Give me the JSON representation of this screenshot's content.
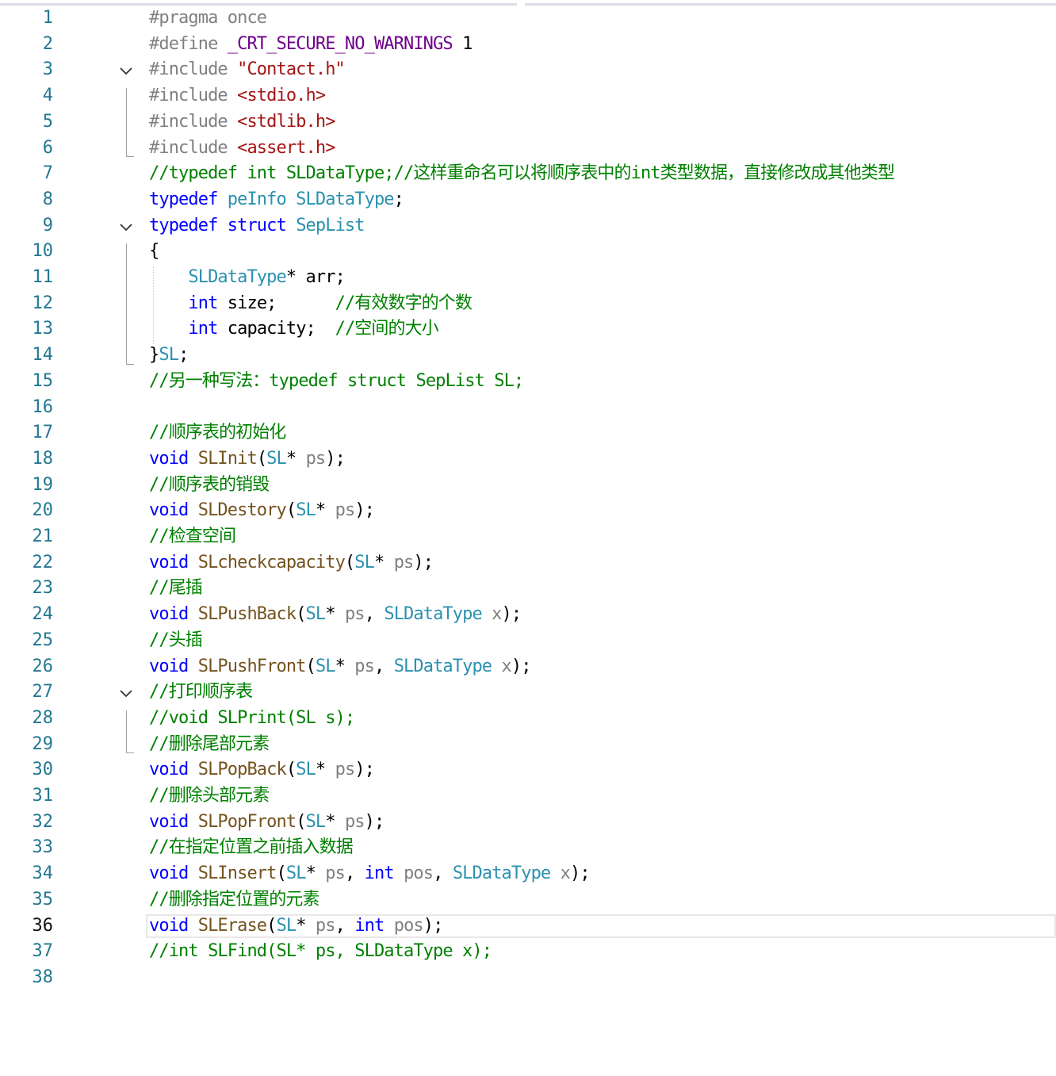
{
  "editor": {
    "active_line": 36,
    "colors": {
      "preprocessor": "#808080",
      "keyword": "#0000ff",
      "type": "#2b91af",
      "string": "#a31515",
      "comment": "#008000",
      "function": "#74531f",
      "macro": "#6f008a",
      "parameter": "#808080",
      "line_number": "#237893"
    },
    "fold_markers": [
      3,
      9,
      27
    ],
    "lines": [
      {
        "n": "1",
        "tokens": [
          [
            "pp",
            "#pragma once"
          ]
        ]
      },
      {
        "n": "2",
        "tokens": [
          [
            "pp",
            "#define "
          ],
          [
            "mac",
            "_CRT_SECURE_NO_WARNINGS"
          ],
          [
            "txt",
            " 1"
          ]
        ]
      },
      {
        "n": "3",
        "tokens": [
          [
            "pp",
            "#include "
          ],
          [
            "str",
            "\"Contact.h\""
          ]
        ]
      },
      {
        "n": "4",
        "tokens": [
          [
            "pp",
            "#include "
          ],
          [
            "str",
            "<stdio.h>"
          ]
        ]
      },
      {
        "n": "5",
        "tokens": [
          [
            "pp",
            "#include "
          ],
          [
            "str",
            "<stdlib.h>"
          ]
        ]
      },
      {
        "n": "6",
        "tokens": [
          [
            "pp",
            "#include "
          ],
          [
            "str",
            "<assert.h>"
          ]
        ]
      },
      {
        "n": "7",
        "tokens": [
          [
            "cm",
            "//typedef int SLDataType;//这样重命名可以将顺序表中的int类型数据，直接修改成其他类型"
          ]
        ]
      },
      {
        "n": "8",
        "tokens": [
          [
            "kw",
            "typedef "
          ],
          [
            "ty",
            "peInfo SLDataType"
          ],
          [
            "txt",
            ";"
          ]
        ]
      },
      {
        "n": "9",
        "tokens": [
          [
            "kw",
            "typedef struct "
          ],
          [
            "ty",
            "SepList"
          ]
        ]
      },
      {
        "n": "10",
        "tokens": [
          [
            "txt",
            "{"
          ]
        ]
      },
      {
        "n": "11",
        "tokens": [
          [
            "txt",
            "    "
          ],
          [
            "ty",
            "SLDataType"
          ],
          [
            "txt",
            "* arr;"
          ]
        ]
      },
      {
        "n": "12",
        "tokens": [
          [
            "txt",
            "    "
          ],
          [
            "kw",
            "int"
          ],
          [
            "txt",
            " size;      "
          ],
          [
            "cm",
            "//有效数字的个数"
          ]
        ]
      },
      {
        "n": "13",
        "tokens": [
          [
            "txt",
            "    "
          ],
          [
            "kw",
            "int"
          ],
          [
            "txt",
            " capacity;  "
          ],
          [
            "cm",
            "//空间的大小"
          ]
        ]
      },
      {
        "n": "14",
        "tokens": [
          [
            "txt",
            "}"
          ],
          [
            "ty",
            "SL"
          ],
          [
            "txt",
            ";"
          ]
        ]
      },
      {
        "n": "15",
        "tokens": [
          [
            "cm",
            "//另一种写法：typedef struct SepList SL;"
          ]
        ]
      },
      {
        "n": "16",
        "tokens": []
      },
      {
        "n": "17",
        "tokens": [
          [
            "cm",
            "//顺序表的初始化"
          ]
        ]
      },
      {
        "n": "18",
        "tokens": [
          [
            "kw",
            "void "
          ],
          [
            "fn",
            "SLInit"
          ],
          [
            "txt",
            "("
          ],
          [
            "ty",
            "SL"
          ],
          [
            "txt",
            "* "
          ],
          [
            "prm",
            "ps"
          ],
          [
            "txt",
            ");"
          ]
        ]
      },
      {
        "n": "19",
        "tokens": [
          [
            "cm",
            "//顺序表的销毁"
          ]
        ]
      },
      {
        "n": "20",
        "tokens": [
          [
            "kw",
            "void "
          ],
          [
            "fn",
            "SLDestory"
          ],
          [
            "txt",
            "("
          ],
          [
            "ty",
            "SL"
          ],
          [
            "txt",
            "* "
          ],
          [
            "prm",
            "ps"
          ],
          [
            "txt",
            ");"
          ]
        ]
      },
      {
        "n": "21",
        "tokens": [
          [
            "cm",
            "//检查空间"
          ]
        ]
      },
      {
        "n": "22",
        "tokens": [
          [
            "kw",
            "void "
          ],
          [
            "fn",
            "SLcheckcapacity"
          ],
          [
            "txt",
            "("
          ],
          [
            "ty",
            "SL"
          ],
          [
            "txt",
            "* "
          ],
          [
            "prm",
            "ps"
          ],
          [
            "txt",
            ");"
          ]
        ]
      },
      {
        "n": "23",
        "tokens": [
          [
            "cm",
            "//尾插"
          ]
        ]
      },
      {
        "n": "24",
        "tokens": [
          [
            "kw",
            "void "
          ],
          [
            "fn",
            "SLPushBack"
          ],
          [
            "txt",
            "("
          ],
          [
            "ty",
            "SL"
          ],
          [
            "txt",
            "* "
          ],
          [
            "prm",
            "ps"
          ],
          [
            "txt",
            ", "
          ],
          [
            "ty",
            "SLDataType"
          ],
          [
            "txt",
            " "
          ],
          [
            "prm",
            "x"
          ],
          [
            "txt",
            ");"
          ]
        ]
      },
      {
        "n": "25",
        "tokens": [
          [
            "cm",
            "//头插"
          ]
        ]
      },
      {
        "n": "26",
        "tokens": [
          [
            "kw",
            "void "
          ],
          [
            "fn",
            "SLPushFront"
          ],
          [
            "txt",
            "("
          ],
          [
            "ty",
            "SL"
          ],
          [
            "txt",
            "* "
          ],
          [
            "prm",
            "ps"
          ],
          [
            "txt",
            ", "
          ],
          [
            "ty",
            "SLDataType"
          ],
          [
            "txt",
            " "
          ],
          [
            "prm",
            "x"
          ],
          [
            "txt",
            ");"
          ]
        ]
      },
      {
        "n": "27",
        "tokens": [
          [
            "cm",
            "//打印顺序表"
          ]
        ]
      },
      {
        "n": "28",
        "tokens": [
          [
            "cm",
            "//void SLPrint(SL s);"
          ]
        ]
      },
      {
        "n": "29",
        "tokens": [
          [
            "cm",
            "//删除尾部元素"
          ]
        ]
      },
      {
        "n": "30",
        "tokens": [
          [
            "kw",
            "void "
          ],
          [
            "fn",
            "SLPopBack"
          ],
          [
            "txt",
            "("
          ],
          [
            "ty",
            "SL"
          ],
          [
            "txt",
            "* "
          ],
          [
            "prm",
            "ps"
          ],
          [
            "txt",
            ");"
          ]
        ]
      },
      {
        "n": "31",
        "tokens": [
          [
            "cm",
            "//删除头部元素"
          ]
        ]
      },
      {
        "n": "32",
        "tokens": [
          [
            "kw",
            "void "
          ],
          [
            "fn",
            "SLPopFront"
          ],
          [
            "txt",
            "("
          ],
          [
            "ty",
            "SL"
          ],
          [
            "txt",
            "* "
          ],
          [
            "prm",
            "ps"
          ],
          [
            "txt",
            ");"
          ]
        ]
      },
      {
        "n": "33",
        "tokens": [
          [
            "cm",
            "//在指定位置之前插入数据"
          ]
        ]
      },
      {
        "n": "34",
        "tokens": [
          [
            "kw",
            "void "
          ],
          [
            "fn",
            "SLInsert"
          ],
          [
            "txt",
            "("
          ],
          [
            "ty",
            "SL"
          ],
          [
            "txt",
            "* "
          ],
          [
            "prm",
            "ps"
          ],
          [
            "txt",
            ", "
          ],
          [
            "kw",
            "int"
          ],
          [
            "txt",
            " "
          ],
          [
            "prm",
            "pos"
          ],
          [
            "txt",
            ", "
          ],
          [
            "ty",
            "SLDataType"
          ],
          [
            "txt",
            " "
          ],
          [
            "prm",
            "x"
          ],
          [
            "txt",
            ");"
          ]
        ]
      },
      {
        "n": "35",
        "tokens": [
          [
            "cm",
            "//删除指定位置的元素"
          ]
        ]
      },
      {
        "n": "36",
        "tokens": [
          [
            "kw",
            "void "
          ],
          [
            "fn",
            "SLErase"
          ],
          [
            "txt",
            "("
          ],
          [
            "ty",
            "SL"
          ],
          [
            "txt",
            "* "
          ],
          [
            "prm",
            "ps"
          ],
          [
            "txt",
            ", "
          ],
          [
            "kw",
            "int"
          ],
          [
            "txt",
            " "
          ],
          [
            "prm",
            "pos"
          ],
          [
            "txt",
            ");"
          ]
        ]
      },
      {
        "n": "37",
        "tokens": [
          [
            "cm",
            "//int SLFind(SL* ps, SLDataType x);"
          ]
        ]
      },
      {
        "n": "38",
        "tokens": []
      }
    ]
  }
}
